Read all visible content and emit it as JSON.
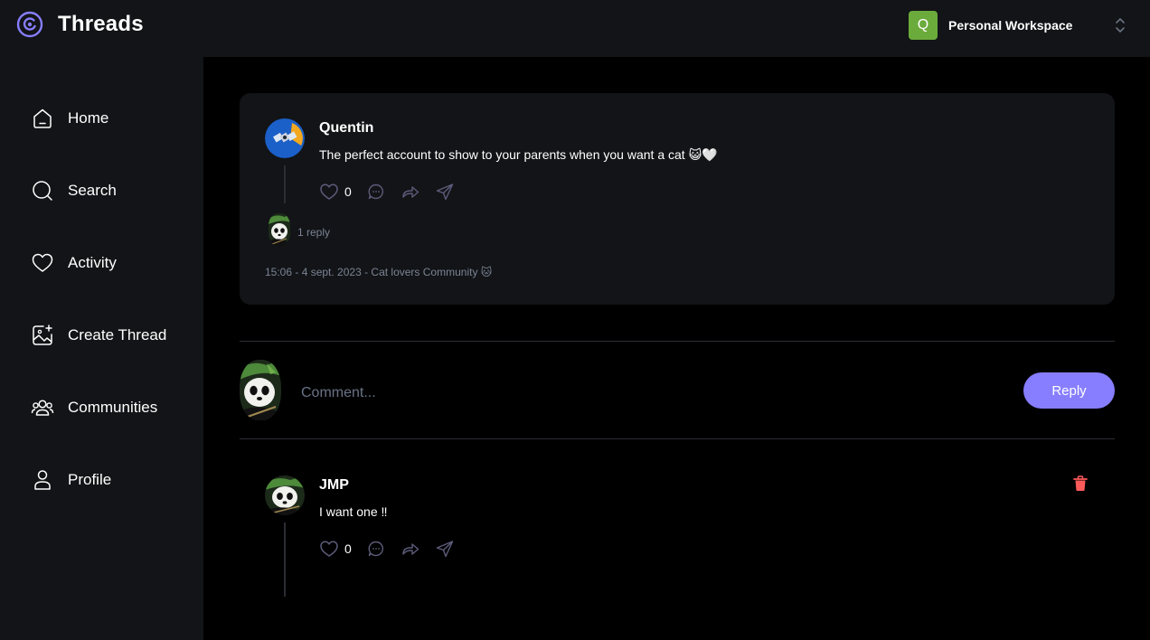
{
  "app": {
    "title": "Threads"
  },
  "workspace": {
    "initial": "Q",
    "name": "Personal Workspace",
    "avatar_color": "#6bab3b"
  },
  "sidebar": {
    "items": [
      {
        "label": "Home",
        "icon": "home-icon"
      },
      {
        "label": "Search",
        "icon": "search-icon"
      },
      {
        "label": "Activity",
        "icon": "heart-icon"
      },
      {
        "label": "Create Thread",
        "icon": "image-plus-icon"
      },
      {
        "label": "Communities",
        "icon": "users-icon"
      },
      {
        "label": "Profile",
        "icon": "user-icon"
      }
    ]
  },
  "thread": {
    "author": "Quentin",
    "text": "The perfect account to show to your parents when you want a cat 😺🤍",
    "likes": "0",
    "replies_label": "1 reply",
    "meta": "15:06 - 4 sept. 2023 - Cat lovers Community 🐱"
  },
  "comment_form": {
    "placeholder": "Comment...",
    "button_label": "Reply"
  },
  "replies": [
    {
      "author": "JMP",
      "text": "I want one ‼",
      "likes": "0"
    }
  ],
  "colors": {
    "accent": "#877eff",
    "sidebar_bg": "#121417",
    "card_bg": "#121417",
    "muted": "#7b8494",
    "delete": "#ff5a5a"
  }
}
